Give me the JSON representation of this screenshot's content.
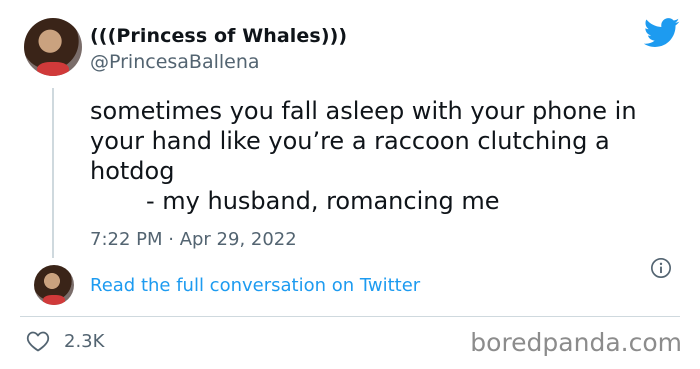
{
  "author": {
    "display_name": "(((Princess of Whales)))",
    "handle": "@PrincesaBallena"
  },
  "tweet": {
    "lines": [
      "sometimes you fall asleep with your phone in",
      "your hand like you’re a raccoon clutching a",
      "hotdog",
      "- my husband, romancing me"
    ],
    "timestamp": "7:22 PM · Apr 29, 2022"
  },
  "conversation_link": "Read the full conversation on Twitter",
  "likes": "2.3K",
  "watermark": "boredpanda.com",
  "icons": {
    "brand": "twitter-bird-icon",
    "info": "info-icon",
    "like": "heart-icon"
  },
  "colors": {
    "link": "#1d9bf0",
    "twitter_blue": "#1d9bf0",
    "secondary_text": "#536471",
    "divider": "#cfd9de"
  }
}
